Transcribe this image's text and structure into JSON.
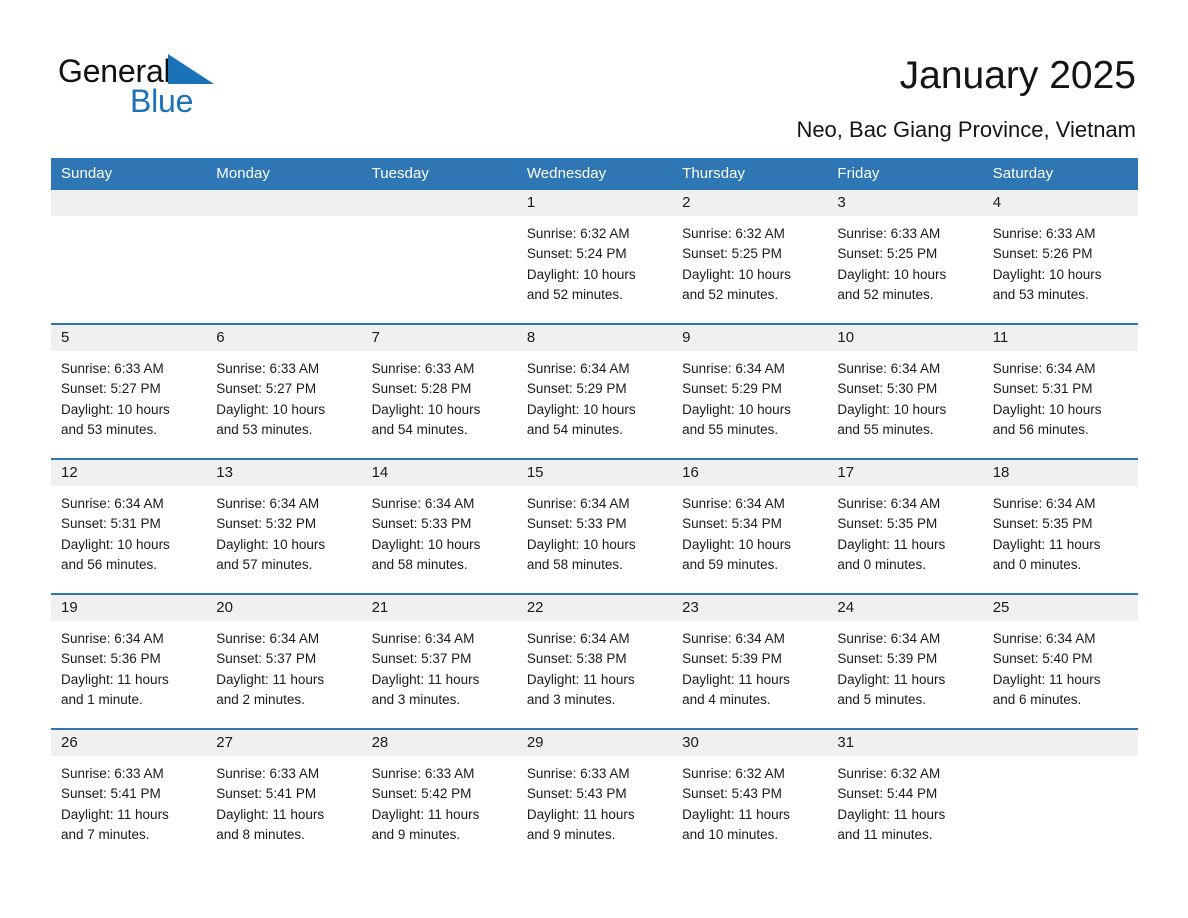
{
  "brand": {
    "name_part1": "General",
    "name_part2": "Blue",
    "accent_color": "#1a72b8",
    "triangle_icon": "brand-triangle-icon"
  },
  "header": {
    "title": "January 2025",
    "subtitle": "Neo, Bac Giang Province, Vietnam"
  },
  "calendar": {
    "header_bg": "#2f76b4",
    "daynum_bg": "#f0f0f0",
    "weekdays": [
      "Sunday",
      "Monday",
      "Tuesday",
      "Wednesday",
      "Thursday",
      "Friday",
      "Saturday"
    ],
    "weeks": [
      [
        {
          "day": "",
          "sunrise": "",
          "sunset": "",
          "daylight_1": "",
          "daylight_2": ""
        },
        {
          "day": "",
          "sunrise": "",
          "sunset": "",
          "daylight_1": "",
          "daylight_2": ""
        },
        {
          "day": "",
          "sunrise": "",
          "sunset": "",
          "daylight_1": "",
          "daylight_2": ""
        },
        {
          "day": "1",
          "sunrise": "Sunrise: 6:32 AM",
          "sunset": "Sunset: 5:24 PM",
          "daylight_1": "Daylight: 10 hours",
          "daylight_2": "and 52 minutes."
        },
        {
          "day": "2",
          "sunrise": "Sunrise: 6:32 AM",
          "sunset": "Sunset: 5:25 PM",
          "daylight_1": "Daylight: 10 hours",
          "daylight_2": "and 52 minutes."
        },
        {
          "day": "3",
          "sunrise": "Sunrise: 6:33 AM",
          "sunset": "Sunset: 5:25 PM",
          "daylight_1": "Daylight: 10 hours",
          "daylight_2": "and 52 minutes."
        },
        {
          "day": "4",
          "sunrise": "Sunrise: 6:33 AM",
          "sunset": "Sunset: 5:26 PM",
          "daylight_1": "Daylight: 10 hours",
          "daylight_2": "and 53 minutes."
        }
      ],
      [
        {
          "day": "5",
          "sunrise": "Sunrise: 6:33 AM",
          "sunset": "Sunset: 5:27 PM",
          "daylight_1": "Daylight: 10 hours",
          "daylight_2": "and 53 minutes."
        },
        {
          "day": "6",
          "sunrise": "Sunrise: 6:33 AM",
          "sunset": "Sunset: 5:27 PM",
          "daylight_1": "Daylight: 10 hours",
          "daylight_2": "and 53 minutes."
        },
        {
          "day": "7",
          "sunrise": "Sunrise: 6:33 AM",
          "sunset": "Sunset: 5:28 PM",
          "daylight_1": "Daylight: 10 hours",
          "daylight_2": "and 54 minutes."
        },
        {
          "day": "8",
          "sunrise": "Sunrise: 6:34 AM",
          "sunset": "Sunset: 5:29 PM",
          "daylight_1": "Daylight: 10 hours",
          "daylight_2": "and 54 minutes."
        },
        {
          "day": "9",
          "sunrise": "Sunrise: 6:34 AM",
          "sunset": "Sunset: 5:29 PM",
          "daylight_1": "Daylight: 10 hours",
          "daylight_2": "and 55 minutes."
        },
        {
          "day": "10",
          "sunrise": "Sunrise: 6:34 AM",
          "sunset": "Sunset: 5:30 PM",
          "daylight_1": "Daylight: 10 hours",
          "daylight_2": "and 55 minutes."
        },
        {
          "day": "11",
          "sunrise": "Sunrise: 6:34 AM",
          "sunset": "Sunset: 5:31 PM",
          "daylight_1": "Daylight: 10 hours",
          "daylight_2": "and 56 minutes."
        }
      ],
      [
        {
          "day": "12",
          "sunrise": "Sunrise: 6:34 AM",
          "sunset": "Sunset: 5:31 PM",
          "daylight_1": "Daylight: 10 hours",
          "daylight_2": "and 56 minutes."
        },
        {
          "day": "13",
          "sunrise": "Sunrise: 6:34 AM",
          "sunset": "Sunset: 5:32 PM",
          "daylight_1": "Daylight: 10 hours",
          "daylight_2": "and 57 minutes."
        },
        {
          "day": "14",
          "sunrise": "Sunrise: 6:34 AM",
          "sunset": "Sunset: 5:33 PM",
          "daylight_1": "Daylight: 10 hours",
          "daylight_2": "and 58 minutes."
        },
        {
          "day": "15",
          "sunrise": "Sunrise: 6:34 AM",
          "sunset": "Sunset: 5:33 PM",
          "daylight_1": "Daylight: 10 hours",
          "daylight_2": "and 58 minutes."
        },
        {
          "day": "16",
          "sunrise": "Sunrise: 6:34 AM",
          "sunset": "Sunset: 5:34 PM",
          "daylight_1": "Daylight: 10 hours",
          "daylight_2": "and 59 minutes."
        },
        {
          "day": "17",
          "sunrise": "Sunrise: 6:34 AM",
          "sunset": "Sunset: 5:35 PM",
          "daylight_1": "Daylight: 11 hours",
          "daylight_2": "and 0 minutes."
        },
        {
          "day": "18",
          "sunrise": "Sunrise: 6:34 AM",
          "sunset": "Sunset: 5:35 PM",
          "daylight_1": "Daylight: 11 hours",
          "daylight_2": "and 0 minutes."
        }
      ],
      [
        {
          "day": "19",
          "sunrise": "Sunrise: 6:34 AM",
          "sunset": "Sunset: 5:36 PM",
          "daylight_1": "Daylight: 11 hours",
          "daylight_2": "and 1 minute."
        },
        {
          "day": "20",
          "sunrise": "Sunrise: 6:34 AM",
          "sunset": "Sunset: 5:37 PM",
          "daylight_1": "Daylight: 11 hours",
          "daylight_2": "and 2 minutes."
        },
        {
          "day": "21",
          "sunrise": "Sunrise: 6:34 AM",
          "sunset": "Sunset: 5:37 PM",
          "daylight_1": "Daylight: 11 hours",
          "daylight_2": "and 3 minutes."
        },
        {
          "day": "22",
          "sunrise": "Sunrise: 6:34 AM",
          "sunset": "Sunset: 5:38 PM",
          "daylight_1": "Daylight: 11 hours",
          "daylight_2": "and 3 minutes."
        },
        {
          "day": "23",
          "sunrise": "Sunrise: 6:34 AM",
          "sunset": "Sunset: 5:39 PM",
          "daylight_1": "Daylight: 11 hours",
          "daylight_2": "and 4 minutes."
        },
        {
          "day": "24",
          "sunrise": "Sunrise: 6:34 AM",
          "sunset": "Sunset: 5:39 PM",
          "daylight_1": "Daylight: 11 hours",
          "daylight_2": "and 5 minutes."
        },
        {
          "day": "25",
          "sunrise": "Sunrise: 6:34 AM",
          "sunset": "Sunset: 5:40 PM",
          "daylight_1": "Daylight: 11 hours",
          "daylight_2": "and 6 minutes."
        }
      ],
      [
        {
          "day": "26",
          "sunrise": "Sunrise: 6:33 AM",
          "sunset": "Sunset: 5:41 PM",
          "daylight_1": "Daylight: 11 hours",
          "daylight_2": "and 7 minutes."
        },
        {
          "day": "27",
          "sunrise": "Sunrise: 6:33 AM",
          "sunset": "Sunset: 5:41 PM",
          "daylight_1": "Daylight: 11 hours",
          "daylight_2": "and 8 minutes."
        },
        {
          "day": "28",
          "sunrise": "Sunrise: 6:33 AM",
          "sunset": "Sunset: 5:42 PM",
          "daylight_1": "Daylight: 11 hours",
          "daylight_2": "and 9 minutes."
        },
        {
          "day": "29",
          "sunrise": "Sunrise: 6:33 AM",
          "sunset": "Sunset: 5:43 PM",
          "daylight_1": "Daylight: 11 hours",
          "daylight_2": "and 9 minutes."
        },
        {
          "day": "30",
          "sunrise": "Sunrise: 6:32 AM",
          "sunset": "Sunset: 5:43 PM",
          "daylight_1": "Daylight: 11 hours",
          "daylight_2": "and 10 minutes."
        },
        {
          "day": "31",
          "sunrise": "Sunrise: 6:32 AM",
          "sunset": "Sunset: 5:44 PM",
          "daylight_1": "Daylight: 11 hours",
          "daylight_2": "and 11 minutes."
        },
        {
          "day": "",
          "sunrise": "",
          "sunset": "",
          "daylight_1": "",
          "daylight_2": ""
        }
      ]
    ]
  }
}
